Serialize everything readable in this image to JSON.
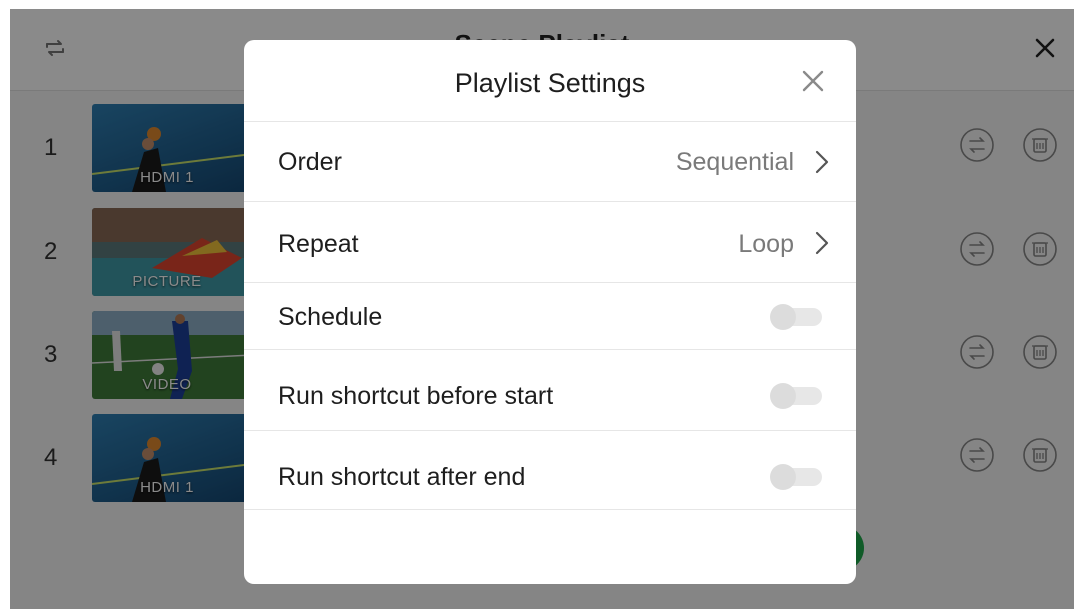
{
  "app": {
    "title": "Scene Playlist",
    "items": [
      {
        "index": "1",
        "label": "HDMI 1",
        "type": "hdmi"
      },
      {
        "index": "2",
        "label": "PICTURE",
        "type": "picture"
      },
      {
        "index": "3",
        "label": "VIDEO",
        "type": "video"
      },
      {
        "index": "4",
        "label": "HDMI 1",
        "type": "hdmi"
      }
    ]
  },
  "dialog": {
    "title": "Playlist Settings",
    "order": {
      "label": "Order",
      "value": "Sequential"
    },
    "repeat": {
      "label": "Repeat",
      "value": "Loop"
    },
    "schedule": {
      "label": "Schedule",
      "enabled": false
    },
    "shortcut_before": {
      "label": "Run shortcut before start",
      "enabled": false
    },
    "shortcut_after": {
      "label": "Run shortcut after end",
      "enabled": false
    }
  },
  "icons": {
    "header_left": "refresh-icon",
    "header_right": "close-icon",
    "row_swap": "swap-icon",
    "row_delete": "trash-icon",
    "dialog_close": "close-icon",
    "chevron": "chevron-right-icon"
  },
  "colors": {
    "accent_green": "#1ea84a",
    "scrim": "rgba(0,0,0,0.46)",
    "toggle_off": "#dcdcdc"
  }
}
